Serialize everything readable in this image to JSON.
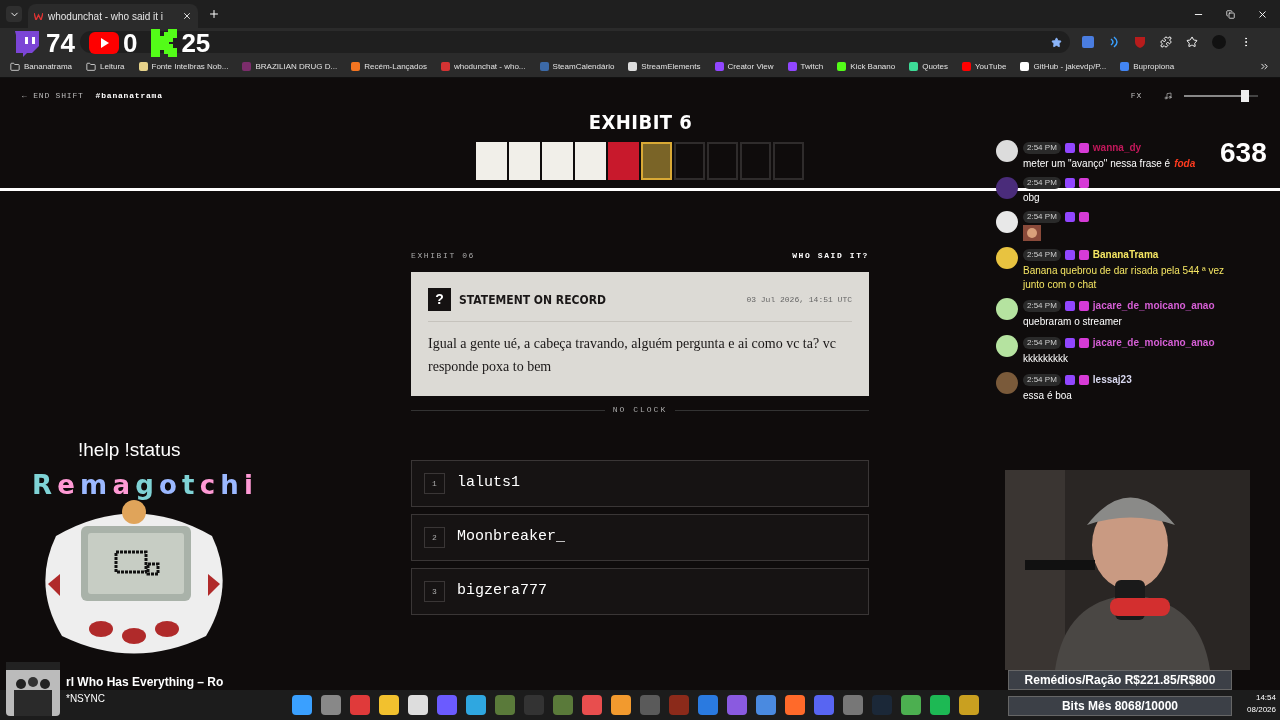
{
  "browser": {
    "tabs": [
      {
        "title": "whodunchat - who said it i",
        "selected": true
      }
    ],
    "bookmarks": [
      {
        "label": "Bananatrama",
        "kind": "folder"
      },
      {
        "label": "Leitura",
        "kind": "folder"
      },
      {
        "label": "Fonte Intelbras Nob...",
        "kind": "site",
        "color": "#e6d28a"
      },
      {
        "label": "BRAZILIAN DRUG D...",
        "kind": "site",
        "color": "#7b2d6b"
      },
      {
        "label": "Recém-Lançados",
        "kind": "site",
        "color": "#f47521"
      },
      {
        "label": "whodunchat - who...",
        "kind": "site",
        "color": "#d33333"
      },
      {
        "label": "SteamCalendário",
        "kind": "site",
        "color": "#3c6aa8"
      },
      {
        "label": "StreamElements",
        "kind": "site",
        "color": "#dddddd"
      },
      {
        "label": "Creator View",
        "kind": "site",
        "color": "#9146ff"
      },
      {
        "label": "Twitch",
        "kind": "site",
        "color": "#9146ff"
      },
      {
        "label": "Kick Banano",
        "kind": "site",
        "color": "#53fc18"
      },
      {
        "label": "Quotes",
        "kind": "site",
        "color": "#3ddc97"
      },
      {
        "label": "YouTube",
        "kind": "site",
        "color": "#ff0000"
      },
      {
        "label": "GitHub - jakevdp/P...",
        "kind": "site",
        "color": "#ffffff"
      },
      {
        "label": "Bupropiona",
        "kind": "site",
        "color": "#4285f4"
      }
    ]
  },
  "stream_counters": [
    {
      "kind": "twitch",
      "count": "74"
    },
    {
      "kind": "youtube",
      "count": "0"
    },
    {
      "kind": "kick",
      "count": "25"
    }
  ],
  "page": {
    "back_link": "← END SHIFT",
    "channel": "#bananatrama",
    "fx_label": "FX",
    "volume": {
      "level": 0.82
    },
    "title": "EXHIBIT 6",
    "slots": [
      {
        "kind": "correct"
      },
      {
        "kind": "correct"
      },
      {
        "kind": "correct"
      },
      {
        "kind": "correct"
      },
      {
        "kind": "wrong"
      },
      {
        "kind": "current"
      },
      {
        "kind": "empty"
      },
      {
        "kind": "empty"
      },
      {
        "kind": "empty"
      },
      {
        "kind": "empty"
      }
    ],
    "exhibit_label": "EXHIBIT 06",
    "question": "WHO SAID IT?",
    "card": {
      "badge": "?",
      "heading": "STATEMENT ON RECORD",
      "timestamp": "03 Jul 2026, 14:51 UTC",
      "statement": "Igual a gente ué, a cabeça travando, alguém pergunta e ai como vc ta? vc responde poxa to bem"
    },
    "clock": "NO CLOCK",
    "options": [
      {
        "number": "1",
        "name": "laluts1"
      },
      {
        "number": "2",
        "name": "Moonbreaker_"
      },
      {
        "number": "3",
        "name": "bigzera777"
      }
    ]
  },
  "overlay": {
    "commands": "!help !status",
    "pet_title": "Remagotchi",
    "viewer_count": "638",
    "chat": [
      {
        "time": "2:54 PM",
        "username": "wanna_dy",
        "color": "#c2185b",
        "text": "meter um \"avanço\" nessa frase é",
        "emote_text": "foda"
      },
      {
        "time": "2:54 PM",
        "text": "obg"
      },
      {
        "time": "2:54 PM",
        "kind": "emote"
      },
      {
        "time": "2:54 PM",
        "username": "BananaTrama",
        "color": "#f5e663",
        "text": "Banana quebrou de dar risada pela 544 ª vez junto com o chat",
        "highlight": true
      },
      {
        "time": "2:54 PM",
        "username": "jacare_de_moicano_anao",
        "color": "#d65fd6",
        "text": "quebraram o streamer"
      },
      {
        "time": "2:54 PM",
        "username": "jacare_de_moicano_anao",
        "color": "#d65fd6",
        "text": "kkkkkkkkk"
      },
      {
        "time": "2:54 PM",
        "username": "lessaj23",
        "color": "#d9d9f0",
        "text": "essa é boa"
      }
    ],
    "now_playing": {
      "title": "rl Who Has Everything – Ro",
      "artist": "*NSYNC"
    },
    "goals": [
      "Remédios/Ração R$221.85/R$800",
      "Bits Mês 8068/10000"
    ]
  },
  "taskbar": {
    "time": "14:54",
    "date": "08/2026"
  }
}
